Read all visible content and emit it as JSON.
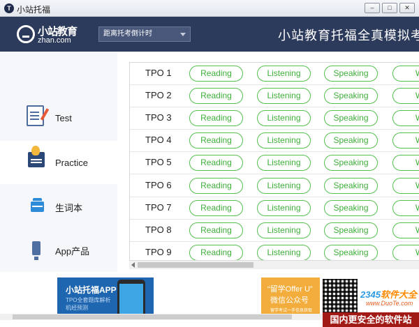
{
  "window": {
    "title": "小站托福",
    "icon_glyph": "T",
    "minimize": "–",
    "maximize": "□",
    "close": "✕"
  },
  "header": {
    "logo_cn": "小站教育",
    "logo_en": "zhan.com",
    "countdown_label": "距离托考倒计时",
    "banner_title": "小站教育托福全真模拟考系",
    "background": "#2c3a5c"
  },
  "sidebar": {
    "items": [
      {
        "label": "Test",
        "icon": "test-paper-icon",
        "active": false
      },
      {
        "label": "Practice",
        "icon": "lightbulb-board-icon",
        "active": true
      },
      {
        "label": "生词本",
        "icon": "vocabulary-box-icon",
        "active": false
      },
      {
        "label": "App产品",
        "icon": "app-product-icon",
        "active": false
      }
    ]
  },
  "tpo_list": {
    "section_labels": {
      "reading": "Reading",
      "listening": "Listening",
      "speaking": "Speaking",
      "writing": "W"
    },
    "rows": [
      {
        "label": "TPO 1"
      },
      {
        "label": "TPO 2"
      },
      {
        "label": "TPO 3"
      },
      {
        "label": "TPO 4"
      },
      {
        "label": "TPO 5"
      },
      {
        "label": "TPO 6"
      },
      {
        "label": "TPO 7"
      },
      {
        "label": "TPO 8"
      },
      {
        "label": "TPO 9"
      }
    ],
    "accent_color": "#54c04e"
  },
  "footer": {
    "ad_left": {
      "title": "小站托福APP",
      "line1": "TPO全套题库解析",
      "line2": "机经预测"
    },
    "ad_right": {
      "title": "“留学Offer U”",
      "subtitle": "微信公众号",
      "small": "留学考试一手信息获取"
    }
  },
  "watermark": {
    "brand_blue": "2345",
    "brand_orange": "软件大全",
    "site": "www.DuoTe.com",
    "slogan": "国内更安全的软件站"
  }
}
